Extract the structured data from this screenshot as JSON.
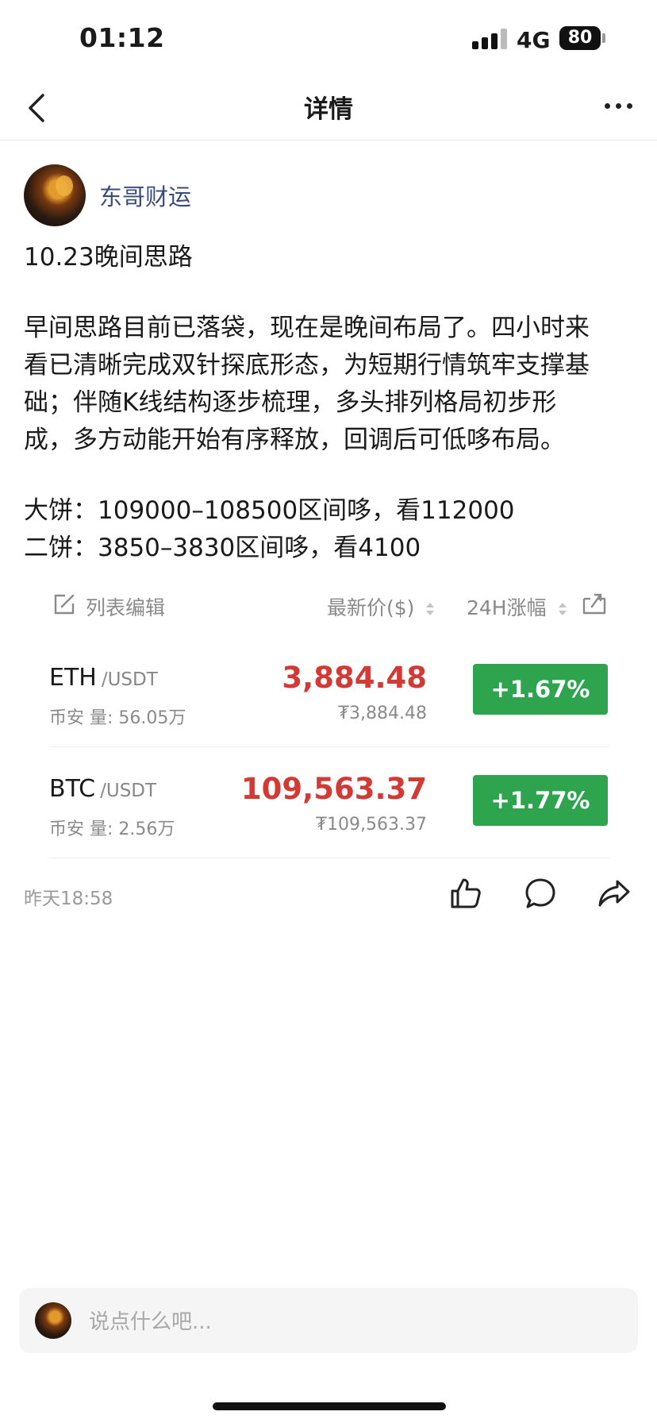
{
  "status_bar": {
    "time": "01:12",
    "network": "4G",
    "battery": "80"
  },
  "nav": {
    "title": "详情"
  },
  "author": {
    "name": "东哥财运"
  },
  "post": {
    "title": "10.23晚间思路",
    "body_lines": [
      "早间思路目前已落袋，现在是晚间布局了。四小时来",
      "看已清晰完成双针探底形态，为短期行情筑牢支撑基",
      "础；伴随K线结构逐步梳理，多头排列格局初步形",
      "成，多方动能开始有序释放，回调后可低哆布局。"
    ],
    "trade_lines": [
      "大饼：109000–108500区间哆，看112000",
      "二饼：3850–3830区间哆，看4100"
    ],
    "time": "昨天18:58"
  },
  "market": {
    "edit_label": "列表编辑",
    "price_header": "最新价($)",
    "change_header": "24H涨幅",
    "tickers": [
      {
        "symbol": "ETH",
        "pair": "/USDT",
        "exchange_volume": "币安 量: 56.05万",
        "price": "3,884.48",
        "price_cny": "₮3,884.48",
        "change": "+1.67%"
      },
      {
        "symbol": "BTC",
        "pair": "/USDT",
        "exchange_volume": "币安 量: 2.56万",
        "price": "109,563.37",
        "price_cny": "₮109,563.37",
        "change": "+1.77%"
      }
    ]
  },
  "comment": {
    "placeholder": "说点什么吧..."
  },
  "colors": {
    "price_red": "#d23a35",
    "change_green": "#2ea44f",
    "author_blue": "#3b4c7a"
  }
}
